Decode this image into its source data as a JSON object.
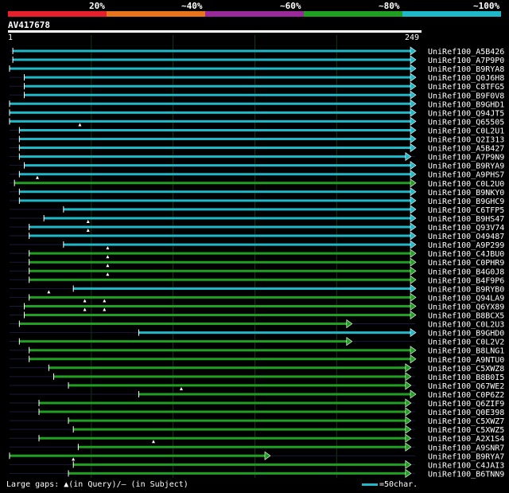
{
  "query": {
    "id": "AV417678",
    "start": "1",
    "end": "249"
  },
  "legend": [
    {
      "label": "20%",
      "color": "#e8202c"
    },
    {
      "label": "~40%",
      "color": "#e8741c"
    },
    {
      "label": "~60%",
      "color": "#9a2a9c"
    },
    {
      "label": "~80%",
      "color": "#20a020"
    },
    {
      "label": "~100%",
      "color": "#1fb8c8"
    }
  ],
  "colors": {
    "cyan": "#1fb8c8",
    "green": "#20a020",
    "faint": "#1a1a3a",
    "grid": "#0e3a14"
  },
  "footer": {
    "gaps_text": "Large gaps: ▲(in Query)/– (in Subject)",
    "scale_text": "=50char."
  },
  "hits": [
    {
      "name": "UniRef100_A5B426",
      "start": 3,
      "end": 249,
      "color": "cyan",
      "gaps": []
    },
    {
      "name": "UniRef100_A7P9P0",
      "start": 3,
      "end": 249,
      "color": "cyan",
      "gaps": []
    },
    {
      "name": "UniRef100_B9RYA8",
      "start": 1,
      "end": 249,
      "color": "cyan",
      "gaps": []
    },
    {
      "name": "UniRef100_Q0J6H8",
      "start": 10,
      "end": 249,
      "color": "cyan",
      "gaps": []
    },
    {
      "name": "UniRef100_C8TFG5",
      "start": 10,
      "end": 249,
      "color": "cyan",
      "gaps": []
    },
    {
      "name": "UniRef100_B9F0V8",
      "start": 10,
      "end": 249,
      "color": "cyan",
      "gaps": []
    },
    {
      "name": "UniRef100_B9GHD1",
      "start": 1,
      "end": 249,
      "color": "cyan",
      "gaps": []
    },
    {
      "name": "UniRef100_Q94JT5",
      "start": 1,
      "end": 249,
      "color": "cyan",
      "gaps": []
    },
    {
      "name": "UniRef100_Q65505",
      "start": 1,
      "end": 249,
      "color": "cyan",
      "gaps": []
    },
    {
      "name": "UniRef100_C0L2U1",
      "start": 7,
      "end": 249,
      "color": "cyan",
      "gaps": [
        44
      ]
    },
    {
      "name": "UniRef100_Q2I313",
      "start": 7,
      "end": 249,
      "color": "cyan",
      "gaps": []
    },
    {
      "name": "UniRef100_A5B427",
      "start": 7,
      "end": 249,
      "color": "cyan",
      "gaps": []
    },
    {
      "name": "UniRef100_A7P9N9",
      "start": 7,
      "end": 246,
      "color": "cyan",
      "gaps": []
    },
    {
      "name": "UniRef100_B9RYA9",
      "start": 10,
      "end": 249,
      "color": "cyan",
      "gaps": []
    },
    {
      "name": "UniRef100_A9PHS7",
      "start": 7,
      "end": 249,
      "color": "cyan",
      "gaps": []
    },
    {
      "name": "UniRef100_C0L2U0",
      "start": 4,
      "end": 249,
      "color": "green",
      "gaps": [
        18
      ]
    },
    {
      "name": "UniRef100_B9NKY0",
      "start": 7,
      "end": 249,
      "color": "cyan",
      "gaps": []
    },
    {
      "name": "UniRef100_B9GHC9",
      "start": 7,
      "end": 249,
      "color": "cyan",
      "gaps": []
    },
    {
      "name": "UniRef100_C6TFP5",
      "start": 34,
      "end": 249,
      "color": "cyan",
      "gaps": []
    },
    {
      "name": "UniRef100_B9HS47",
      "start": 22,
      "end": 249,
      "color": "cyan",
      "gaps": []
    },
    {
      "name": "UniRef100_Q93V74",
      "start": 13,
      "end": 249,
      "color": "cyan",
      "gaps": [
        49
      ]
    },
    {
      "name": "UniRef100_O49487",
      "start": 13,
      "end": 249,
      "color": "cyan",
      "gaps": [
        49
      ]
    },
    {
      "name": "UniRef100_A9P299",
      "start": 34,
      "end": 249,
      "color": "cyan",
      "gaps": []
    },
    {
      "name": "UniRef100_C4JBU0",
      "start": 13,
      "end": 249,
      "color": "green",
      "gaps": [
        61
      ]
    },
    {
      "name": "UniRef100_C0PHR9",
      "start": 13,
      "end": 249,
      "color": "green",
      "gaps": [
        61
      ]
    },
    {
      "name": "UniRef100_B4G0J8",
      "start": 13,
      "end": 249,
      "color": "green",
      "gaps": [
        61
      ]
    },
    {
      "name": "UniRef100_B4F9P6",
      "start": 13,
      "end": 249,
      "color": "green",
      "gaps": [
        61
      ]
    },
    {
      "name": "UniRef100_B9RYB0",
      "start": 40,
      "end": 249,
      "color": "cyan",
      "gaps": []
    },
    {
      "name": "UniRef100_Q94LA9",
      "start": 13,
      "end": 249,
      "color": "green",
      "gaps": [
        25
      ]
    },
    {
      "name": "UniRef100_Q6YX89",
      "start": 10,
      "end": 249,
      "color": "green",
      "gaps": [
        47,
        59
      ]
    },
    {
      "name": "UniRef100_B8BCX5",
      "start": 10,
      "end": 249,
      "color": "green",
      "gaps": [
        47,
        59
      ]
    },
    {
      "name": "UniRef100_C0L2U3",
      "start": 7,
      "end": 210,
      "color": "green",
      "gaps": []
    },
    {
      "name": "UniRef100_B9GHD0",
      "start": 80,
      "end": 249,
      "color": "cyan",
      "gaps": []
    },
    {
      "name": "UniRef100_C0L2V2",
      "start": 7,
      "end": 210,
      "color": "green",
      "gaps": []
    },
    {
      "name": "UniRef100_B8LNG1",
      "start": 13,
      "end": 249,
      "color": "green",
      "gaps": []
    },
    {
      "name": "UniRef100_A9NTU0",
      "start": 13,
      "end": 249,
      "color": "green",
      "gaps": []
    },
    {
      "name": "UniRef100_C5XWZ8",
      "start": 25,
      "end": 246,
      "color": "green",
      "gaps": []
    },
    {
      "name": "UniRef100_B8B0I5",
      "start": 28,
      "end": 246,
      "color": "green",
      "gaps": []
    },
    {
      "name": "UniRef100_Q67WE2",
      "start": 37,
      "end": 246,
      "color": "green",
      "gaps": []
    },
    {
      "name": "UniRef100_C0P6Z2",
      "start": 80,
      "end": 249,
      "color": "green",
      "gaps": [
        106
      ]
    },
    {
      "name": "UniRef100_Q6ZIF9",
      "start": 19,
      "end": 246,
      "color": "green",
      "gaps": []
    },
    {
      "name": "UniRef100_Q0E398",
      "start": 19,
      "end": 246,
      "color": "green",
      "gaps": []
    },
    {
      "name": "UniRef100_C5XWZ7",
      "start": 37,
      "end": 246,
      "color": "green",
      "gaps": []
    },
    {
      "name": "UniRef100_C5XWZ5",
      "start": 40,
      "end": 246,
      "color": "green",
      "gaps": []
    },
    {
      "name": "UniRef100_A2X1S4",
      "start": 19,
      "end": 246,
      "color": "green",
      "gaps": []
    },
    {
      "name": "UniRef100_A9SNR7",
      "start": 43,
      "end": 246,
      "color": "green",
      "gaps": [
        89
      ]
    },
    {
      "name": "UniRef100_B9RYA7",
      "start": 1,
      "end": 160,
      "color": "green",
      "gaps": []
    },
    {
      "name": "UniRef100_C4JAI3",
      "start": 40,
      "end": 246,
      "color": "green",
      "gaps": [
        40
      ]
    },
    {
      "name": "UniRef100_B6TNN9",
      "start": 37,
      "end": 246,
      "color": "green",
      "gaps": []
    }
  ]
}
